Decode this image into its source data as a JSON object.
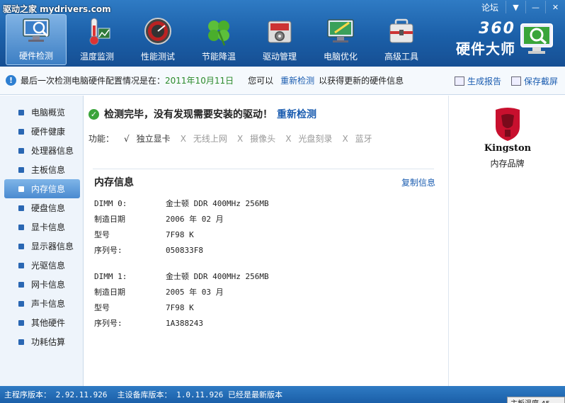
{
  "window": {
    "watermark": "驱动之家 mydrivers.com",
    "forum_label": "论坛",
    "menu_glyph": "▼",
    "minimize_glyph": "—",
    "close_glyph": "✕"
  },
  "nav": {
    "items": [
      {
        "label": "硬件检测",
        "icon": "monitor-magnifier-icon",
        "active": true
      },
      {
        "label": "温度监测",
        "icon": "thermometer-icon",
        "active": false
      },
      {
        "label": "性能测试",
        "icon": "speedometer-icon",
        "active": false
      },
      {
        "label": "节能降温",
        "icon": "leaf-clover-icon",
        "active": false
      },
      {
        "label": "驱动管理",
        "icon": "gear-box-icon",
        "active": false
      },
      {
        "label": "电脑优化",
        "icon": "monitor-brush-icon",
        "active": false
      },
      {
        "label": "高级工具",
        "icon": "toolbox-icon",
        "active": false
      }
    ]
  },
  "brand": {
    "number": "360",
    "name": "硬件大师"
  },
  "infobar": {
    "prefix": "最后一次检测电脑硬件配置情况是在：",
    "date": "2011年10月11日",
    "middle": "您可以",
    "redetect_link": "重新检测",
    "suffix": "以获得更新的硬件信息",
    "report_label": "生成报告",
    "screenshot_label": "保存截屏"
  },
  "sidebar": {
    "items": [
      {
        "label": "电脑概览",
        "active": false
      },
      {
        "label": "硬件健康",
        "active": false
      },
      {
        "label": "处理器信息",
        "active": false
      },
      {
        "label": "主板信息",
        "active": false
      },
      {
        "label": "内存信息",
        "active": true
      },
      {
        "label": "硬盘信息",
        "active": false
      },
      {
        "label": "显卡信息",
        "active": false
      },
      {
        "label": "显示器信息",
        "active": false
      },
      {
        "label": "光驱信息",
        "active": false
      },
      {
        "label": "网卡信息",
        "active": false
      },
      {
        "label": "声卡信息",
        "active": false
      },
      {
        "label": "其他硬件",
        "active": false
      },
      {
        "label": "功耗估算",
        "active": false
      }
    ]
  },
  "main": {
    "status_text": "检测完毕，没有发现需要安装的驱动！",
    "redetect_label": "重新检测",
    "features_label": "功能：",
    "features": [
      {
        "mark": "√",
        "label": "独立显卡",
        "enabled": true
      },
      {
        "mark": "X",
        "label": "无线上网",
        "enabled": false
      },
      {
        "mark": "X",
        "label": "摄像头",
        "enabled": false
      },
      {
        "mark": "X",
        "label": "光盘刻录",
        "enabled": false
      },
      {
        "mark": "X",
        "label": "蓝牙",
        "enabled": false
      }
    ],
    "section_title": "内存信息",
    "copy_label": "复制信息",
    "modules": [
      {
        "slot_key": "DIMM 0:",
        "slot_value": "金士顿 DDR 400MHz 256MB",
        "date_key": "制造日期",
        "date_value": "2006 年 02 月",
        "model_key": "型号",
        "model_value": "7F98 K",
        "serial_key": "序列号:",
        "serial_value": "050833F8"
      },
      {
        "slot_key": "DIMM 1:",
        "slot_value": "金士顿 DDR 400MHz 256MB",
        "date_key": "制造日期",
        "date_value": "2005 年 03 月",
        "model_key": "型号",
        "model_value": "7F98 K",
        "serial_key": "序列号:",
        "serial_value": "1A388243"
      }
    ]
  },
  "right_panel": {
    "logo_text": "Kingston",
    "brand_label": "内存品牌"
  },
  "statusbar": {
    "program_version": "主程序版本： 2.92.11.926",
    "db_version": "主设备库版本： 1.0.11.926 已经是最新版本",
    "cpu_temp": "主板温度 45"
  },
  "colors": {
    "header_blue": "#1b5fa8",
    "link_blue": "#1a5cb0",
    "date_green": "#2a8a2a",
    "check_green": "#3aa43a",
    "kingston_red": "#c8102e"
  }
}
